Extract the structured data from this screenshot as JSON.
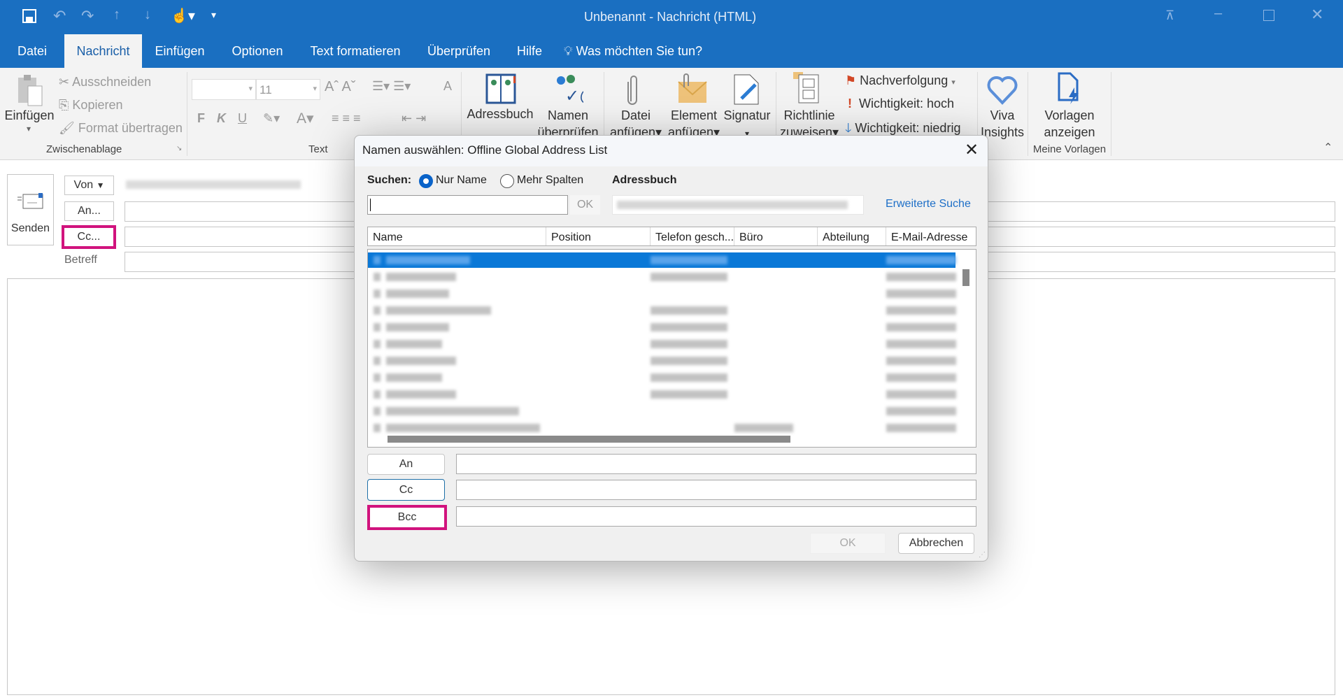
{
  "window": {
    "title": "Unbenannt  -  Nachricht (HTML)"
  },
  "quick_access": {
    "icons": [
      "save-icon",
      "undo-icon",
      "redo-icon",
      "up-icon",
      "down-icon",
      "touch-mode-icon",
      "customize-icon"
    ]
  },
  "tabs": [
    {
      "label": "Datei"
    },
    {
      "label": "Nachricht",
      "active": true
    },
    {
      "label": "Einfügen"
    },
    {
      "label": "Optionen"
    },
    {
      "label": "Text formatieren"
    },
    {
      "label": "Überprüfen"
    },
    {
      "label": "Hilfe"
    }
  ],
  "tell_me": "Was möchten Sie tun?",
  "ribbon": {
    "clipboard": {
      "paste": "Einfügen",
      "cut": "Ausschneiden",
      "copy": "Kopieren",
      "format_painter": "Format übertragen",
      "group": "Zwischenablage"
    },
    "text": {
      "font_size": "11",
      "bold": "F",
      "italic": "K",
      "underline": "U",
      "font_color": "A",
      "group": "Text"
    },
    "names": {
      "address_book": "Adressbuch",
      "check_names_1": "Namen",
      "check_names_2": "überprüfen"
    },
    "include": {
      "attach_file_1": "Datei",
      "attach_file_2": "anfügen",
      "attach_item_1": "Element",
      "attach_item_2": "anfügen",
      "signature": "Signatur"
    },
    "policy": {
      "label_1": "Richtlinie",
      "label_2": "zuweisen"
    },
    "tags": {
      "follow_up": "Nachverfolgung",
      "high": "Wichtigkeit: hoch",
      "low": "Wichtigkeit: niedrig"
    },
    "viva": {
      "label_1": "Viva",
      "label_2": "Insights"
    },
    "templates": {
      "label_1": "Vorlagen",
      "label_2": "anzeigen",
      "group": "Meine Vorlagen"
    }
  },
  "compose": {
    "send": "Senden",
    "from": "Von",
    "to": "An...",
    "cc": "Cc...",
    "subject": "Betreff"
  },
  "dialog": {
    "title": "Namen auswählen: Offline Global Address List",
    "search_label": "Suchen:",
    "radio_name_only": "Nur Name",
    "radio_more_columns": "Mehr Spalten",
    "radio_selected": "Nur Name",
    "search_value": "",
    "search_ok": "OK",
    "address_book_label": "Adressbuch",
    "advanced_search": "Erweiterte Suche",
    "columns": [
      "Name",
      "Position",
      "Telefon gesch...",
      "Büro",
      "Abteilung",
      "E-Mail-Adresse"
    ],
    "to_button": "An",
    "cc_button": "Cc",
    "bcc_button": "Bcc",
    "ok": "OK",
    "cancel": "Abbrechen"
  },
  "colors": {
    "accent": "#1a6fc1",
    "highlight": "#d1137d",
    "selection": "#0a78d7"
  }
}
